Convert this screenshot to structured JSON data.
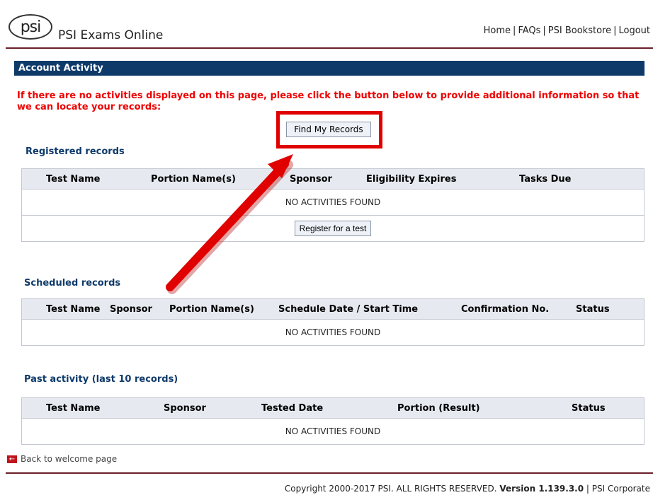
{
  "header": {
    "logo_text": "psi",
    "brand": "PSI Exams Online",
    "nav": [
      "Home",
      "FAQs",
      "PSI Bookstore",
      "Logout"
    ],
    "nav_separator": "|"
  },
  "section_title": "Account Activity",
  "warning": "If there are no activities displayed on this page, please click the button below to provide additional information so that we can locate your records:",
  "find_button": "Find My Records",
  "registered": {
    "title": "Registered records",
    "columns": [
      "Test Name",
      "Portion Name(s)",
      "Sponsor",
      "Eligibility Expires",
      "Tasks Due"
    ],
    "empty": "NO ACTIVITIES FOUND",
    "register_button": "Register for a test"
  },
  "scheduled": {
    "title": "Scheduled records",
    "columns": [
      "Test Name",
      "Sponsor",
      "Portion Name(s)",
      "Schedule Date / Start Time",
      "Confirmation No.",
      "Status"
    ],
    "empty": "NO ACTIVITIES FOUND"
  },
  "past": {
    "title": "Past activity (last 10 records)",
    "columns": [
      "Test Name",
      "Sponsor",
      "Tested Date",
      "Portion (Result)",
      "Status"
    ],
    "empty": "NO ACTIVITIES FOUND"
  },
  "back_link": "Back to welcome page",
  "footer": {
    "copyright": "Copyright 2000-2017 PSI. ALL RIGHTS RESERVED.",
    "version": "Version 1.139.3.0",
    "separator": "|",
    "corporate": "PSI Corporate"
  },
  "colors": {
    "section_bar": "#0e3a6a",
    "warning": "#ee0000",
    "annotation": "#e00000",
    "rule": "#6b1f2a"
  }
}
